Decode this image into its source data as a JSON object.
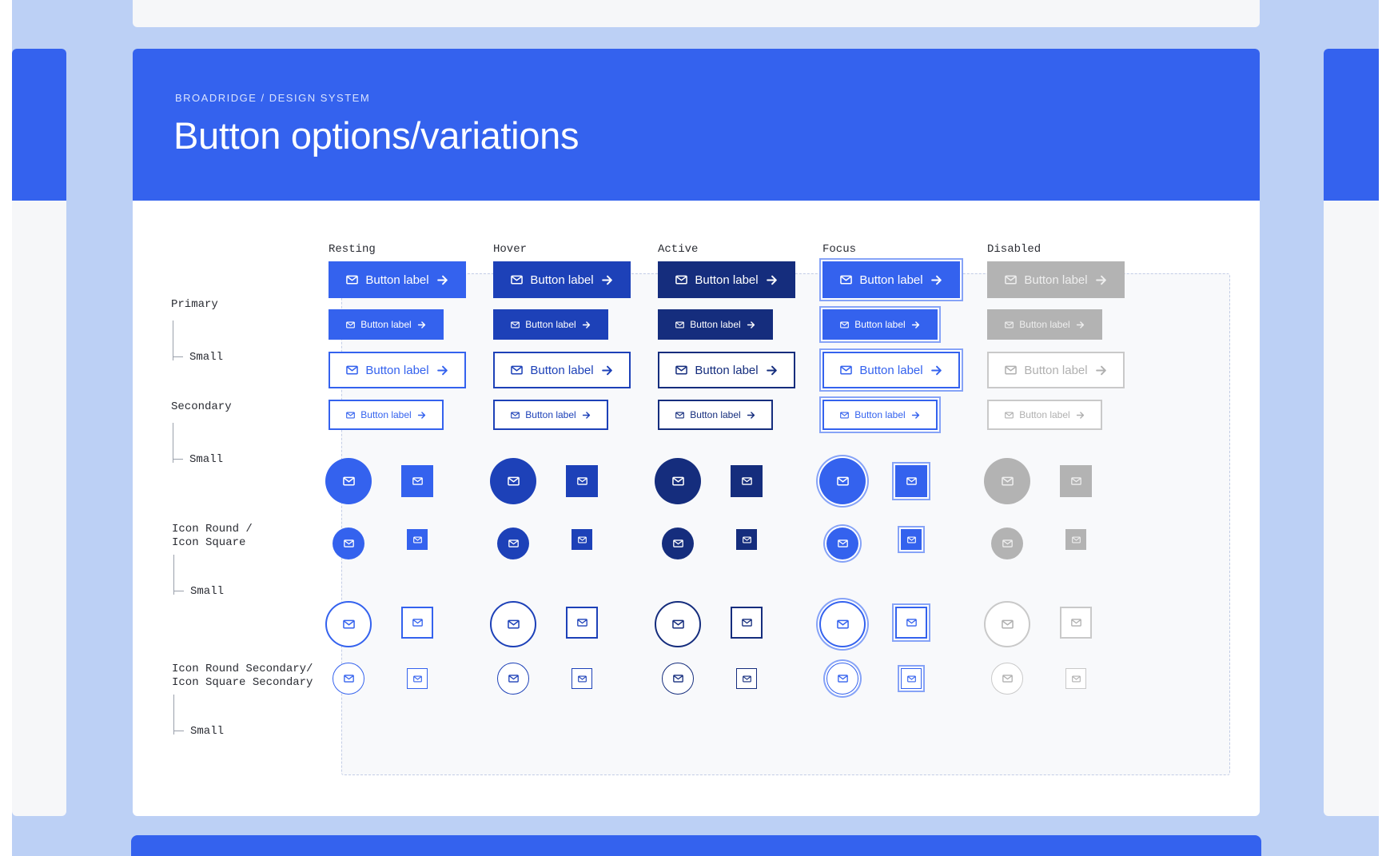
{
  "page": {
    "eyebrow": "BROADRIDGE / DESIGN SYSTEM",
    "title": "Button options/variations"
  },
  "columns": [
    "Resting",
    "Hover",
    "Active",
    "Focus",
    "Disabled"
  ],
  "rows": {
    "primary": "Primary",
    "secondary": "Secondary",
    "icon_square": [
      "Icon Round /",
      "Icon Square"
    ],
    "icon_secondary": [
      "Icon Round Secondary/",
      "Icon Square Secondary"
    ],
    "small": "Small"
  },
  "button": {
    "label": "Button label",
    "leading_icon": "mail-icon",
    "trailing_icon": "arrow-right-icon"
  },
  "state_colors": {
    "resting": "#3462ee",
    "hover": "#1d41b8",
    "active": "#152d7d",
    "focus": "#3462ee",
    "disabled": "#b3b3b3"
  },
  "brand": {
    "accent": "#3462ee",
    "background": "#bcd0f5"
  }
}
